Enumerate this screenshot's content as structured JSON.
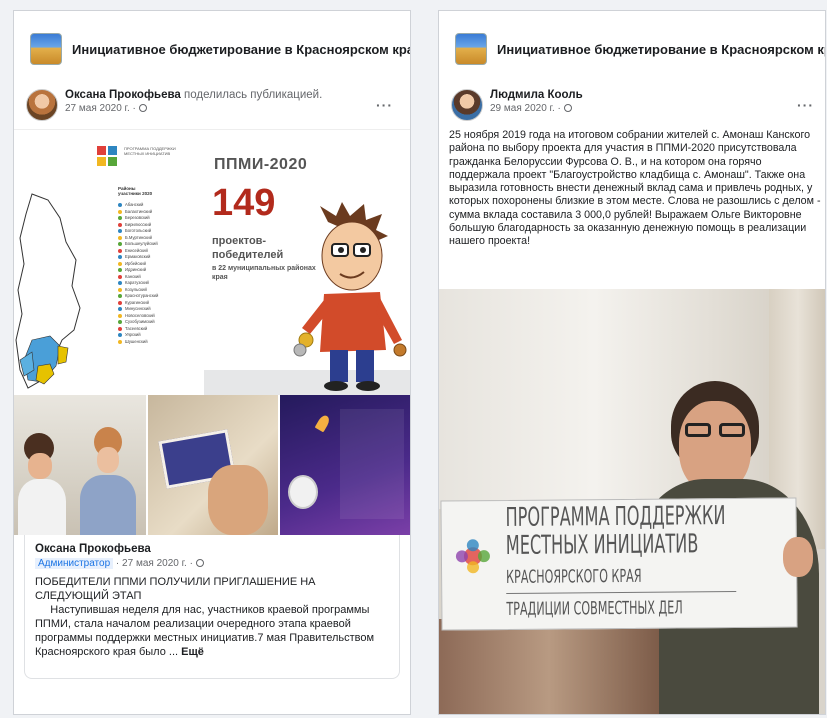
{
  "card1": {
    "page_name": "Инициативное бюджетирование в Красноярском крае",
    "author": "Оксана Прокофьева",
    "shared_text": "поделилась публикацией.",
    "date": "27 мая 2020 г. · ",
    "infographic": {
      "program_title": "ПРОГРАММА ПОДДЕРЖКИ МЕСТНЫХ ИНИЦИАТИВ",
      "legend_title": "Районы участники 2020",
      "year_label": "ППМИ-2020",
      "number": "149",
      "winners_label": "проектов-победителей",
      "regions_label": "в 22 муниципальных районах края",
      "legend": [
        "Абанский",
        "Балахтинский",
        "Березовский",
        "Бирилюсский",
        "Боготольский",
        "Б.Муртинский",
        "Большеулуйский",
        "Енисейский",
        "Ермаковский",
        "Ирбейский",
        "Идринский",
        "Канский",
        "Каратузский",
        "Козульский",
        "Краснотуранский",
        "Курагинский",
        "Минусинский",
        "Новоселовский",
        "Сухобузимский",
        "Тасеевский",
        "Уярский",
        "Шушенский"
      ]
    },
    "sub_post": {
      "author": "Оксана Прокофьева",
      "badge": "Администратор",
      "meta": " · 27 мая 2020 г. · ",
      "title": "ПОБЕДИТЕЛИ ППМИ  ПОЛУЧИЛИ ПРИГЛАШЕНИЕ НА СЛЕДУЮЩИЙ ЭТАП",
      "text": "     Наступившая неделя для нас, участников краевой программы ППМИ, стала началом реализации очередного этапа краевой программы поддержки местных инициатив.7 мая Правительством Красноярского края было ... ",
      "more": "Ещё"
    }
  },
  "card2": {
    "page_name": "Инициативное бюджетирование в Красноярском крае",
    "author": "Людмила Кооль",
    "date": "29 мая 2020 г. · ",
    "text": "25 ноября 2019 года на итоговом собрании жителей с. Амонаш Канского района по выбору проекта для участия в ППМИ-2020 присутствовала гражданка Белоруссии Фурсова О. В., и на котором она горячо поддержала проект \"Благоустройство кладбища с. Амонаш\". Также она выразила готовность внести денежный вклад сама и привлечь родных, у которых похоронены близкие в этом месте. Слова не разошлись с делом - сумма вклада составила 3 000,0 рублей! Выражаем Ольге Викторовне большую благодарность за оказанную денежную помощь в реализации нашего проекта!",
    "sign_lines": [
      "ПРОГРАММА ПОДДЕРЖКИ",
      "МЕСТНЫХ ИНИЦИАТИВ",
      "КРАСНОЯРСКОГО КРАЯ",
      "ТРАДИЦИИ СОВМЕСТНЫХ ДЕЛ"
    ]
  },
  "colors": {
    "accent_red": "#b22a1c",
    "link_blue": "#1b74e4"
  }
}
